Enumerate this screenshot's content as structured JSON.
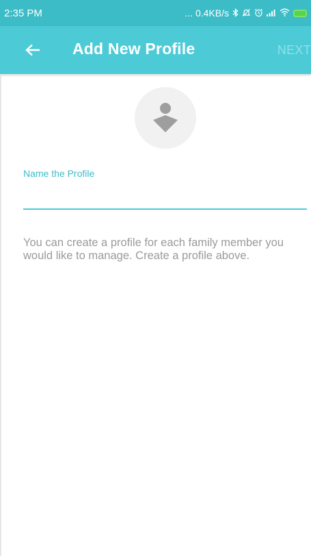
{
  "status_bar": {
    "time": "2:35 PM",
    "network_speed": "... 0.4KB/s",
    "icons": [
      "bluetooth-icon",
      "mute-icon",
      "alarm-icon",
      "signal-icon",
      "wifi-icon",
      "battery-charging-icon"
    ]
  },
  "app_bar": {
    "back_icon": "arrow-left-icon",
    "title": "Add New Profile",
    "next_label": "NEXT"
  },
  "profile": {
    "avatar_icon": "profile-avatar-icon"
  },
  "form": {
    "name_label": "Name the Profile",
    "name_value": "",
    "name_placeholder": ""
  },
  "help": {
    "text": "You can create a profile for each family member you would like to manage. Create a profile above."
  },
  "colors": {
    "accent": "#4ccbd7",
    "status_bar": "#3cbcc6",
    "next_disabled": "#8fe2e8",
    "help_text": "#9a9a9a",
    "avatar_bg": "#f1f1f1",
    "avatar_icon": "#9e9e9e"
  }
}
